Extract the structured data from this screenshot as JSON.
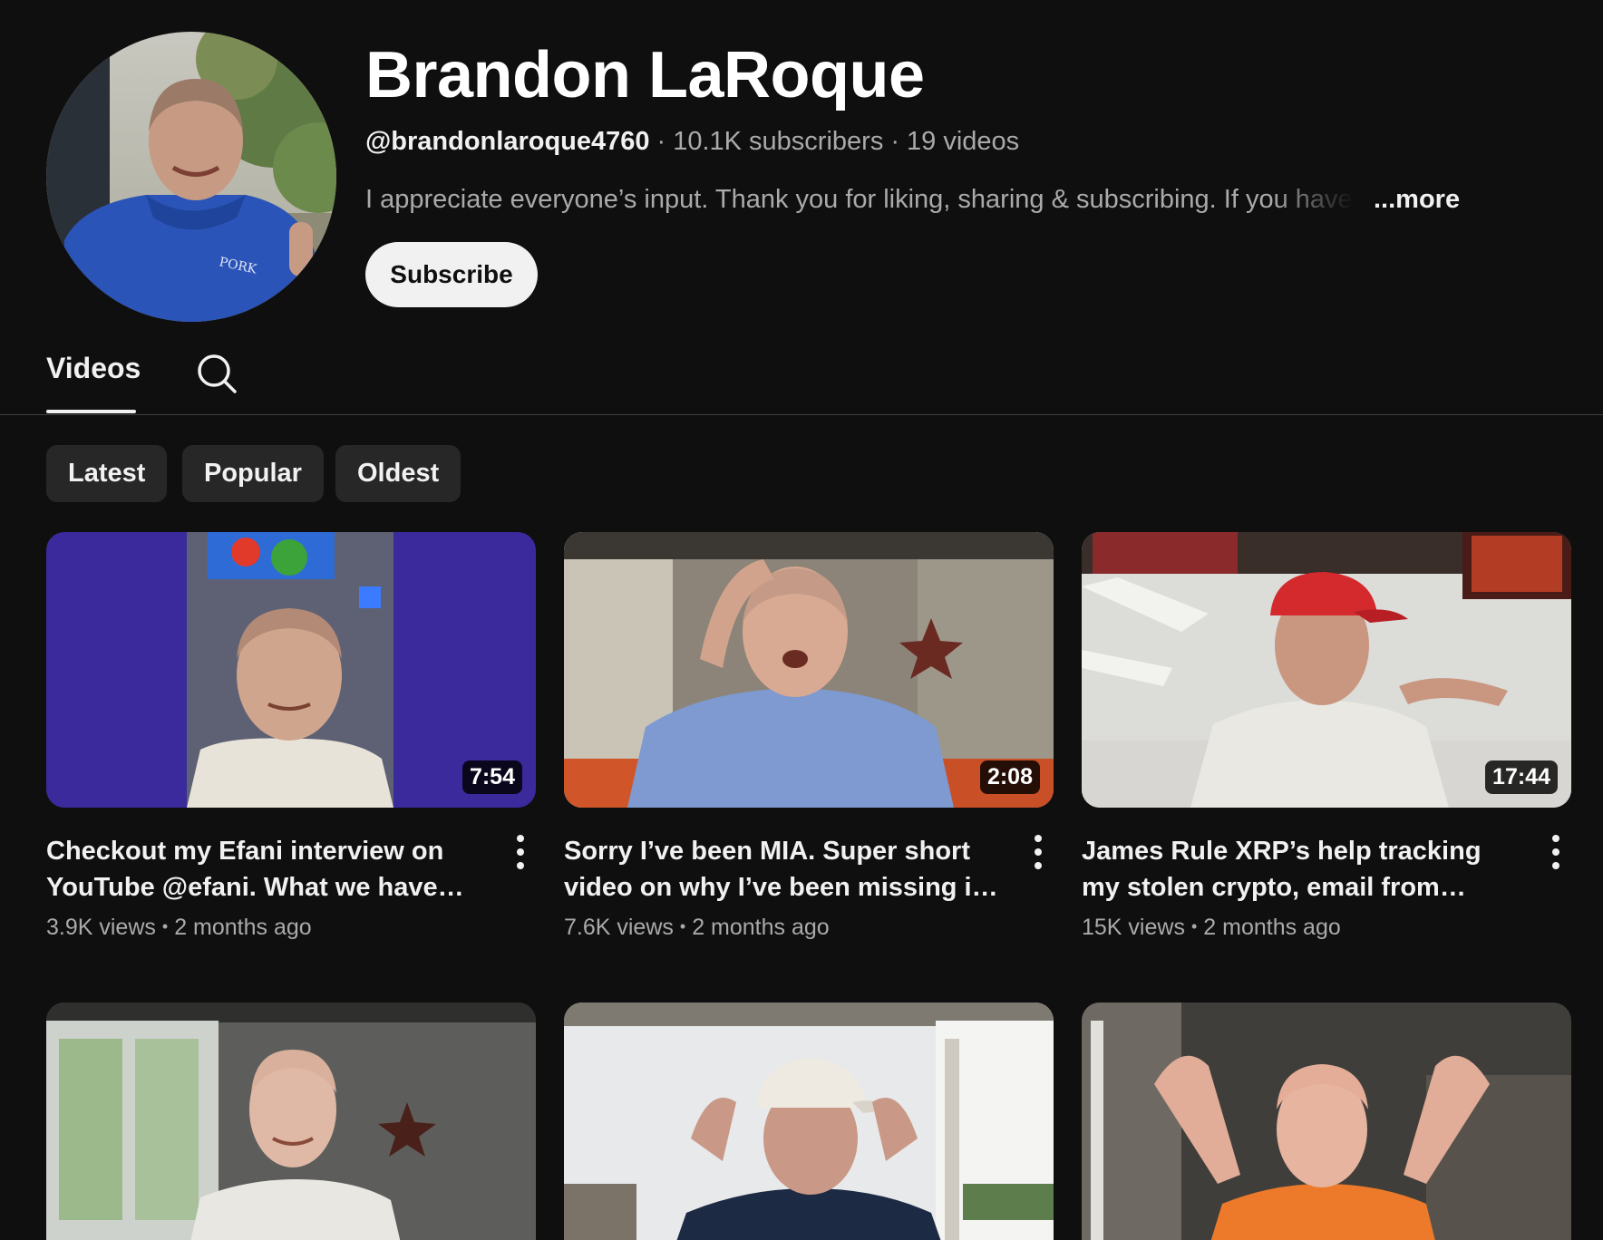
{
  "channel": {
    "name": "Brandon LaRoque",
    "handle": "@brandonlaroque4760",
    "subscribers": "10.1K subscribers",
    "videos_count": "19 videos",
    "separator": "·",
    "description": "I appreciate everyone’s input. Thank you for liking, sharing & subscribing. If you have any",
    "more_label": "...more",
    "subscribe_label": "Subscribe"
  },
  "tabs": {
    "videos_label": "Videos",
    "search_icon": "search-icon"
  },
  "filters": [
    "Latest",
    "Popular",
    "Oldest"
  ],
  "videos": [
    {
      "title": "Checkout my Efani interview on YouTube @efani. What we have been…",
      "duration": "7:54",
      "views": "3.9K views",
      "age": "2 months ago"
    },
    {
      "title": "Sorry I’ve been MIA. Super short video on why I’ve been missing in comment…",
      "duration": "2:08",
      "views": "7.6K views",
      "age": "2 months ago"
    },
    {
      "title": "James Rule XRP’s help tracking my stolen crypto, email from viewer,…",
      "duration": "17:44",
      "views": "15K views",
      "age": "2 months ago"
    },
    {
      "title": "",
      "duration": "",
      "views": "",
      "age": ""
    },
    {
      "title": "",
      "duration": "",
      "views": "",
      "age": ""
    },
    {
      "title": "",
      "duration": "",
      "views": "",
      "age": ""
    }
  ],
  "meta_dot": "•",
  "colors": {
    "background": "#0f0f0f",
    "chip_background": "#272727",
    "subscribe_background": "#f1f1f1",
    "secondary_text": "#aaaaaa"
  }
}
